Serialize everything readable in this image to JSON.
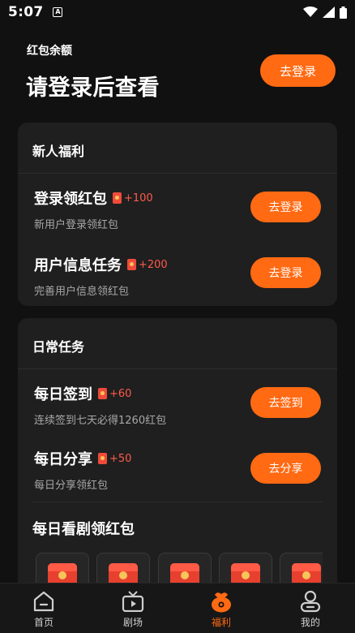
{
  "status_bar": {
    "time": "5:07",
    "app_badge": "A"
  },
  "header": {
    "balance_label": "红包余额",
    "login_prompt": "请登录后查看",
    "login_button": "去登录"
  },
  "new_user_card": {
    "title": "新人福利",
    "tasks": [
      {
        "name": "登录领红包",
        "reward": "+100",
        "desc": "新用户登录领红包",
        "button": "去登录"
      },
      {
        "name": "用户信息任务",
        "reward": "+200",
        "desc": "完善用户信息领红包",
        "button": "去登录"
      }
    ]
  },
  "daily_card": {
    "title": "日常任务",
    "tasks": [
      {
        "name": "每日签到",
        "reward": "+60",
        "desc": "连续签到七天必得1260红包",
        "button": "去签到"
      },
      {
        "name": "每日分享",
        "reward": "+50",
        "desc": "每日分享领红包",
        "button": "去分享"
      }
    ],
    "watch_title": "每日看剧领红包"
  },
  "bottom_nav": {
    "items": [
      {
        "label": "首页",
        "icon": "home-icon"
      },
      {
        "label": "剧场",
        "icon": "tv-icon"
      },
      {
        "label": "福利",
        "icon": "welfare-bag-icon",
        "active": true
      },
      {
        "label": "我的",
        "icon": "profile-icon"
      }
    ]
  },
  "colors": {
    "accent": "#ff6a13",
    "reward": "#ff5a4a",
    "background": "#111111",
    "card": "#1f1f1f"
  }
}
